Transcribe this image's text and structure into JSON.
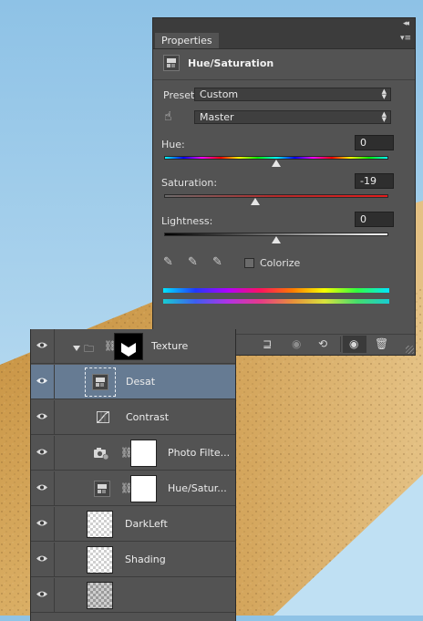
{
  "properties_panel": {
    "tab_label": "Properties",
    "collapse_glyph": "◂◂",
    "close_glyph": "×",
    "menu_glyph": "▾≡",
    "adjustment_title": "Hue/Saturation",
    "preset_label": "Preset:",
    "preset_value": "Custom",
    "channel_value": "Master",
    "hue_label": "Hue:",
    "hue_value": "0",
    "saturation_label": "Saturation:",
    "saturation_value": "-19",
    "lightness_label": "Lightness:",
    "lightness_value": "0",
    "colorize_label": "Colorize",
    "colorize_checked": false,
    "hue_level": 0.5,
    "saturation_level": 0.405,
    "lightness_level": 0.5
  },
  "layers_panel": {
    "layers": [
      {
        "name": "Texture",
        "type": "group",
        "visible": true,
        "selected": false
      },
      {
        "name": "Desat",
        "type": "hue-saturation-adjustment",
        "visible": true,
        "selected": true
      },
      {
        "name": "Contrast",
        "type": "curves-adjustment",
        "visible": true,
        "selected": false
      },
      {
        "name": "Photo Filte...",
        "type": "photo-filter-adjustment",
        "visible": true,
        "selected": false
      },
      {
        "name": "Hue/Satur...",
        "type": "hue-saturation-adjustment",
        "visible": true,
        "selected": false
      },
      {
        "name": "DarkLeft",
        "type": "pixel-layer",
        "visible": true,
        "selected": false
      },
      {
        "name": "Shading",
        "type": "pixel-layer",
        "visible": true,
        "selected": false
      }
    ]
  },
  "colors": {
    "panel_bg": "#535353",
    "selected_row": "#667b93",
    "sky": "#8fc3e6",
    "sand": "#d8a65c"
  }
}
